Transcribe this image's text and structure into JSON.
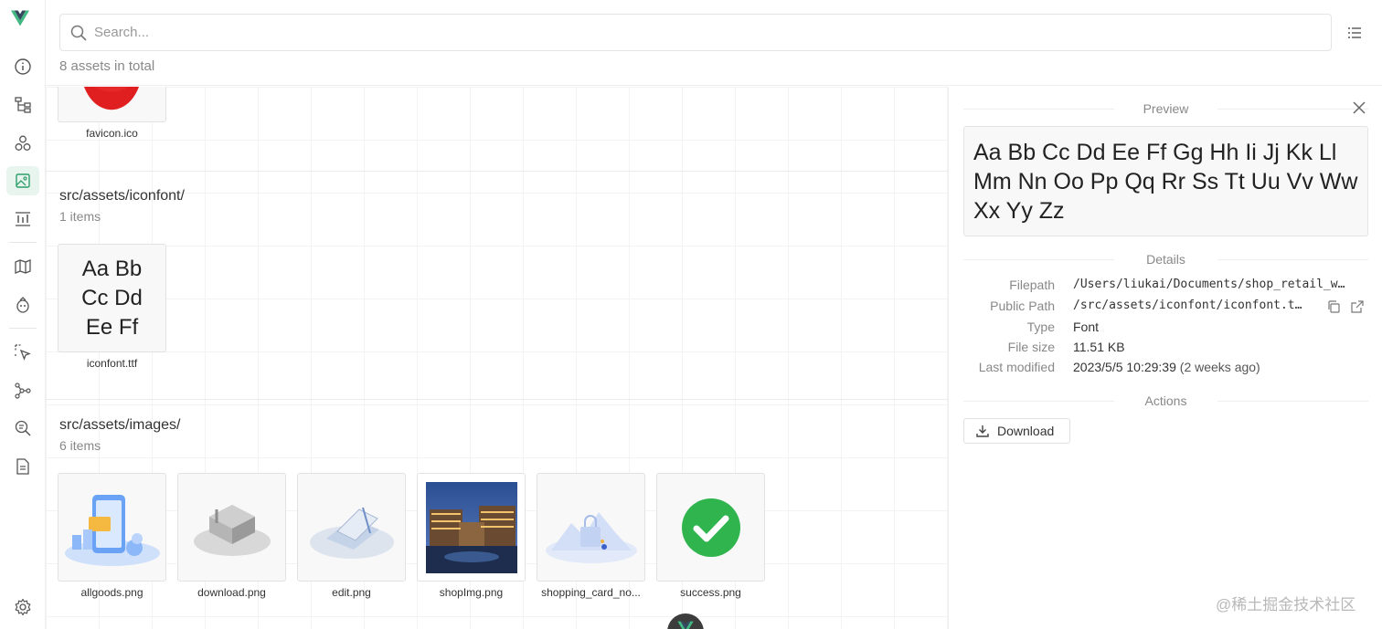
{
  "search": {
    "placeholder": "Search..."
  },
  "summary": {
    "total_text": "8 assets in total"
  },
  "sidebar": {
    "logo": "vue-logo",
    "items": [
      {
        "name": "overview",
        "icon": "info-icon"
      },
      {
        "name": "pages",
        "icon": "tree-icon"
      },
      {
        "name": "components",
        "icon": "components-icon"
      },
      {
        "name": "assets",
        "icon": "assets-icon",
        "active": true
      },
      {
        "name": "timeline",
        "icon": "timeline-icon"
      },
      {
        "name": "routes",
        "icon": "map-icon"
      },
      {
        "name": "pinia",
        "icon": "pinia-icon"
      },
      {
        "name": "inspector",
        "icon": "cursor-icon"
      },
      {
        "name": "graph",
        "icon": "graph-icon"
      },
      {
        "name": "inspect",
        "icon": "inspect-icon"
      },
      {
        "name": "docs",
        "icon": "doc-icon"
      },
      {
        "name": "settings",
        "icon": "gear-icon"
      }
    ]
  },
  "folders": [
    {
      "assets": [
        {
          "name": "favicon.ico",
          "kind": "ico"
        }
      ]
    },
    {
      "path": "src/assets/iconfont/",
      "count": "1 items",
      "assets": [
        {
          "name": "iconfont.ttf",
          "kind": "font",
          "preview_lines": [
            "Aa Bb",
            "Cc Dd",
            "Ee Ff"
          ]
        }
      ]
    },
    {
      "path": "src/assets/images/",
      "count": "6 items",
      "assets": [
        {
          "name": "allgoods.png"
        },
        {
          "name": "download.png"
        },
        {
          "name": "edit.png"
        },
        {
          "name": "shopImg.png"
        },
        {
          "name": "shopping_card_no..."
        },
        {
          "name": "success.png"
        }
      ]
    }
  ],
  "panel": {
    "preview_title": "Preview",
    "preview_text": "Aa Bb Cc Dd Ee Ff Gg Hh Ii Jj Kk Ll Mm Nn Oo Pp Qq Rr Ss Tt Uu Vv Ww Xx Yy Zz",
    "details_title": "Details",
    "details": {
      "filepath_label": "Filepath",
      "filepath": "/Users/liukai/Documents/shop_retail_w…",
      "public_path_label": "Public Path",
      "public_path": "/src/assets/iconfont/iconfont.t…",
      "type_label": "Type",
      "type": "Font",
      "size_label": "File size",
      "size": "11.51 KB",
      "modified_label": "Last modified",
      "modified": "2023/5/5 10:29:39",
      "modified_relative": "(2 weeks ago)"
    },
    "actions_title": "Actions",
    "download_label": "Download"
  },
  "watermark": "@稀土掘金技术社区",
  "colors": {
    "accent": "#42b883",
    "vue_dark": "#35495e",
    "success": "#2fb44e"
  }
}
